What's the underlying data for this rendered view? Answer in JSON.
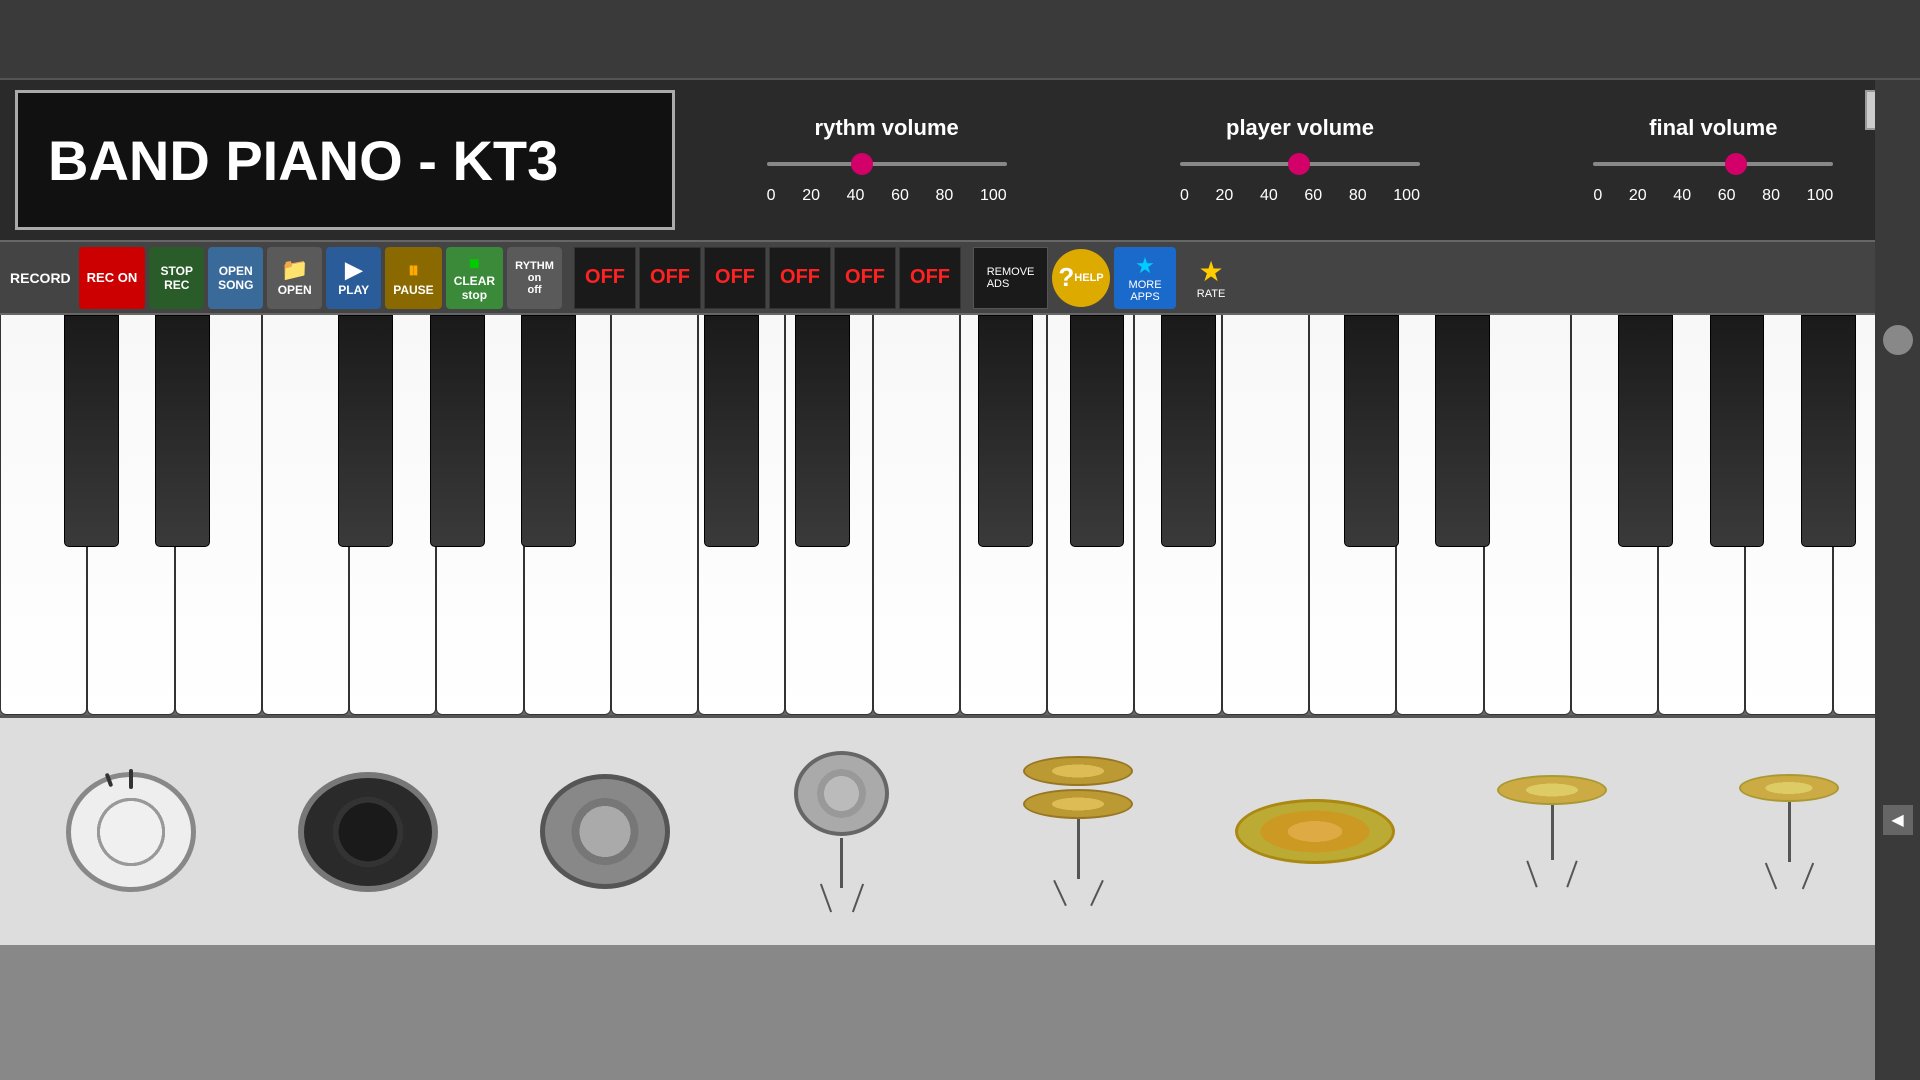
{
  "app": {
    "title": "BAND PIANO - KT3"
  },
  "header": {
    "rythm_volume_label": "rythm volume",
    "player_volume_label": "player volume",
    "final_volume_label": "final volume",
    "rythm_slider_pct": 40,
    "player_slider_pct": 50,
    "final_slider_pct": 60,
    "slider_marks": [
      "0",
      "20",
      "40",
      "60",
      "80",
      "100"
    ]
  },
  "toolbar": {
    "record_label": "RECORD",
    "rec_on_label": "REC\nON",
    "stop_rec_label": "STOP\nREC",
    "open_song_label": "OPEN\nSONG",
    "open_label": "OPEN",
    "play_label": "PLAY",
    "pause_label": "PAUSE",
    "clear_label": "CLEAR\nstop",
    "rythm_on_label": "RYTHM\non\noff",
    "off_buttons": [
      "OFF",
      "OFF",
      "OFF",
      "OFF",
      "OFF",
      "OFF"
    ],
    "remove_ads_label": "REMOVE\nADS",
    "help_label": "HELP",
    "more_apps_label": "MORE\nAPPS",
    "rate_label": "RATE"
  },
  "drums": [
    {
      "name": "bass-drum",
      "type": "bass"
    },
    {
      "name": "snare-drum",
      "type": "snare"
    },
    {
      "name": "tom-drum",
      "type": "tom"
    },
    {
      "name": "snare2-drum",
      "type": "snare2"
    },
    {
      "name": "hihat-drum",
      "type": "hihat"
    },
    {
      "name": "cymbal-drum",
      "type": "cymbal"
    },
    {
      "name": "ride-drum",
      "type": "ride"
    },
    {
      "name": "crash-drum",
      "type": "crash"
    }
  ]
}
